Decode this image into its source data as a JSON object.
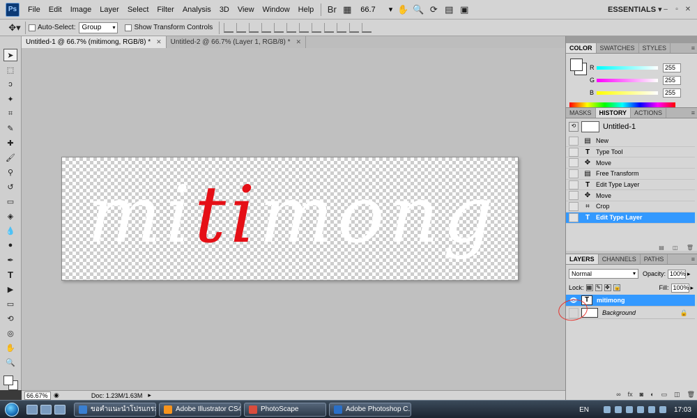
{
  "menu": {
    "logo": "Ps",
    "items": [
      "File",
      "Edit",
      "Image",
      "Layer",
      "Select",
      "Filter",
      "Analysis",
      "3D",
      "View",
      "Window",
      "Help"
    ],
    "zoom": "66.7",
    "workspace": "ESSENTIALS"
  },
  "options": {
    "auto_select_label": "Auto-Select:",
    "auto_select_value": "Group",
    "show_transform_label": "Show Transform Controls"
  },
  "tabs": [
    {
      "label": "Untitled-1 @ 66.7% (mitimong, RGB/8) *",
      "active": true
    },
    {
      "label": "Untitled-2 @ 66.7% (Layer 1, RGB/8) *",
      "active": false
    }
  ],
  "canvas": {
    "text_parts": [
      {
        "text": "mi",
        "color": "#ffffff"
      },
      {
        "text": "ti",
        "color": "#e50f16"
      },
      {
        "text": "mong",
        "color": "#ffffff"
      }
    ]
  },
  "status": {
    "zoom": "66.67%",
    "doc_info": "Doc: 1.23M/1.63M"
  },
  "color_panel": {
    "tabs": [
      "COLOR",
      "SWATCHES",
      "STYLES"
    ],
    "sliders": [
      {
        "label": "R",
        "value": "255",
        "gradient": "linear-gradient(to right,#00ffff,#ffffff)"
      },
      {
        "label": "G",
        "value": "255",
        "gradient": "linear-gradient(to right,#ff00ff,#ffffff)"
      },
      {
        "label": "B",
        "value": "255",
        "gradient": "linear-gradient(to right,#ffff00,#ffffff)"
      }
    ]
  },
  "history_panel": {
    "tabs": [
      "MASKS",
      "HISTORY",
      "ACTIONS"
    ],
    "snapshot": "Untitled-1",
    "items": [
      {
        "label": "New",
        "icon": "document-icon",
        "glyph": "▤",
        "selected": false
      },
      {
        "label": "Type Tool",
        "icon": "type-icon",
        "glyph": "T",
        "selected": false
      },
      {
        "label": "Move",
        "icon": "move-icon",
        "glyph": "✥",
        "selected": false
      },
      {
        "label": "Free Transform",
        "icon": "transform-icon",
        "glyph": "▤",
        "selected": false
      },
      {
        "label": "Edit Type Layer",
        "icon": "type-icon",
        "glyph": "T",
        "selected": false
      },
      {
        "label": "Move",
        "icon": "move-icon",
        "glyph": "✥",
        "selected": false
      },
      {
        "label": "Crop",
        "icon": "crop-icon",
        "glyph": "⌗",
        "selected": false
      },
      {
        "label": "Edit Type Layer",
        "icon": "type-icon",
        "glyph": "T",
        "selected": true
      }
    ]
  },
  "layers_panel": {
    "tabs": [
      "LAYERS",
      "CHANNELS",
      "PATHS"
    ],
    "blend_mode": "Normal",
    "opacity_label": "Opacity:",
    "opacity": "100%",
    "lock_label": "Lock:",
    "fill_label": "Fill:",
    "fill": "100%",
    "layers": [
      {
        "name": "mitimong",
        "thumb": "T",
        "visible": true,
        "selected": true,
        "italic": false
      },
      {
        "name": "Background",
        "thumb": "",
        "visible": false,
        "selected": false,
        "italic": true
      }
    ]
  },
  "taskbar": {
    "tasks": [
      {
        "label": "ขอคำแนะนำโปรแกรม...",
        "color": "#3a7fd1"
      },
      {
        "label": "Adobe Illustrator CS4",
        "color": "#f7941d"
      },
      {
        "label": "PhotoScape",
        "color": "#d94c3c"
      },
      {
        "label": "Adobe Photoshop C...",
        "color": "#2a6fc7"
      }
    ],
    "language": "EN",
    "clock": "17:03"
  }
}
